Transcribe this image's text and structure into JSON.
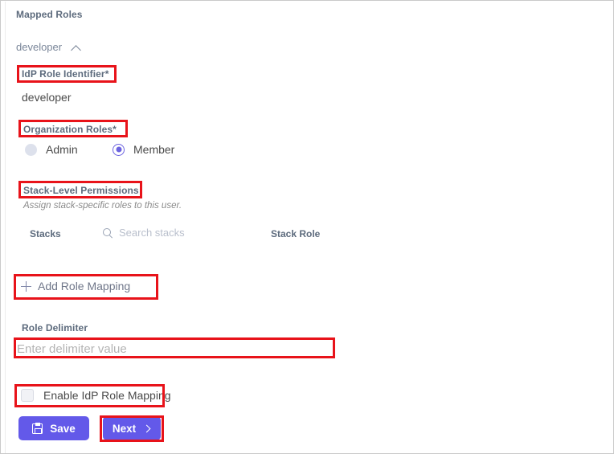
{
  "page": {
    "section_title": "Mapped Roles"
  },
  "accordion": {
    "label": "developer",
    "chevron_icon": "chevron-up-icon",
    "expanded": true
  },
  "idp_role": {
    "label": "IdP Role Identifier*",
    "value": "developer"
  },
  "organization_roles": {
    "label": "Organization Roles*",
    "options": [
      {
        "label": "Admin",
        "selected": false
      },
      {
        "label": "Member",
        "selected": true
      }
    ]
  },
  "stack_permissions": {
    "label": "Stack-Level Permissions",
    "helper": "Assign stack-specific roles to this user.",
    "columns": {
      "stacks": "Stacks",
      "stack_role": "Stack Role"
    },
    "search": {
      "icon": "search-icon",
      "placeholder": "Search stacks",
      "value": ""
    },
    "rows": []
  },
  "add_role_mapping": {
    "icon": "plus-icon",
    "label": "Add Role Mapping"
  },
  "role_delimiter": {
    "label": "Role Delimiter",
    "placeholder": "Enter delimiter value",
    "value": ""
  },
  "enable_idp_role_mapping": {
    "label": "Enable IdP Role Mapping",
    "checked": false
  },
  "footer": {
    "save_label": "Save",
    "save_icon": "save-disk-icon",
    "next_label": "Next",
    "next_icon": "chevron-right-icon"
  },
  "colors": {
    "accent_purple": "#6359e9",
    "annotation_red": "#e8131a",
    "label_slate": "#5d6b7d",
    "placeholder_gray": "#b4b4b4"
  }
}
